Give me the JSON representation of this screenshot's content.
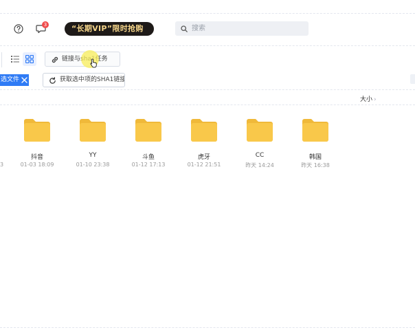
{
  "topbar": {
    "message_badge_count": "3",
    "vip_banner_text": "“长期VIP”限时抢购",
    "search_placeholder": "搜索"
  },
  "toolbar": {
    "task_button_label": "链接与sha1任务"
  },
  "selection": {
    "chip_label": "选文件",
    "sha1_button_label": "获取选中项的SHA1链接"
  },
  "list_header": {
    "size_label": "大小",
    "size_chevron": "›"
  },
  "partial_item": {
    "date_fragment": "3"
  },
  "folders": [
    {
      "name": "抖音",
      "date": "01-03 18:09"
    },
    {
      "name": "YY",
      "date": "01-10 23:38"
    },
    {
      "name": "斗鱼",
      "date": "01-12 17:13"
    },
    {
      "name": "虎牙",
      "date": "01-12 21:51"
    },
    {
      "name": "CC",
      "date": "昨天 14:24"
    },
    {
      "name": "韩国",
      "date": "昨天 16:38"
    }
  ],
  "colors": {
    "accent": "#2f7bf5",
    "folder": "#f9c84a",
    "badge": "#f04b4b",
    "vip_bg": "#1e1a18",
    "vip_text": "#f5d58a"
  },
  "icons": {
    "help": "help-icon",
    "message": "message-icon",
    "search": "search-icon",
    "list_view": "list-view-icon",
    "grid_view": "grid-view-icon",
    "link": "link-icon",
    "refresh": "refresh-icon",
    "close": "close-icon",
    "folder": "folder-icon",
    "cursor": "hand-cursor-icon"
  }
}
